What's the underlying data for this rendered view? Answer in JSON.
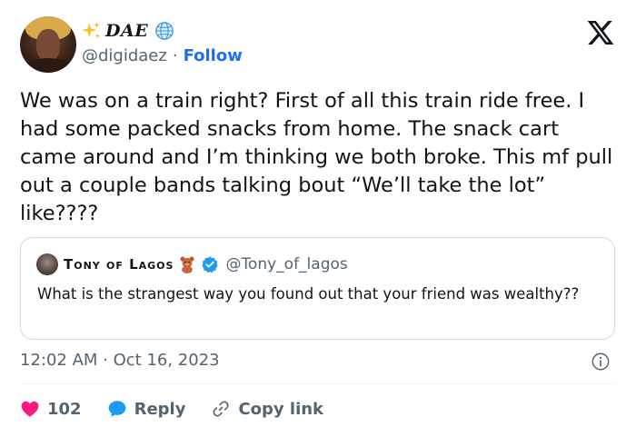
{
  "author": {
    "display_name": "DAE",
    "handle": "@digidaez",
    "separator": "·",
    "follow_label": "Follow",
    "avatar_icon": "profile-photo",
    "prefix_icon": "sparkles-icon",
    "suffix_icon": "globe-icon"
  },
  "tweet": {
    "text": "We was on a train right? First of all this train ride free. I had some packed snacks from home. The snack cart came around and I’m thinking we both broke. This mf pull out a couple bands talking bout “We’ll take the lot” like????",
    "timestamp": "12:02 AM · Oct 16, 2023"
  },
  "quote": {
    "display_name": "Tony of Lagos",
    "handle": "@Tony_of_lagos",
    "text": "What is the strangest way you found out that your friend was wealthy??",
    "name_icon": "teddy-bear-icon",
    "verified_icon": "verified-badge-icon"
  },
  "actions": {
    "like_count": "102",
    "reply_label": "Reply",
    "copy_label": "Copy link"
  },
  "colors": {
    "accent": "#1d9bf0",
    "like": "#f91880",
    "text": "#0f1419",
    "muted": "#536471",
    "border": "#cfd9de"
  }
}
